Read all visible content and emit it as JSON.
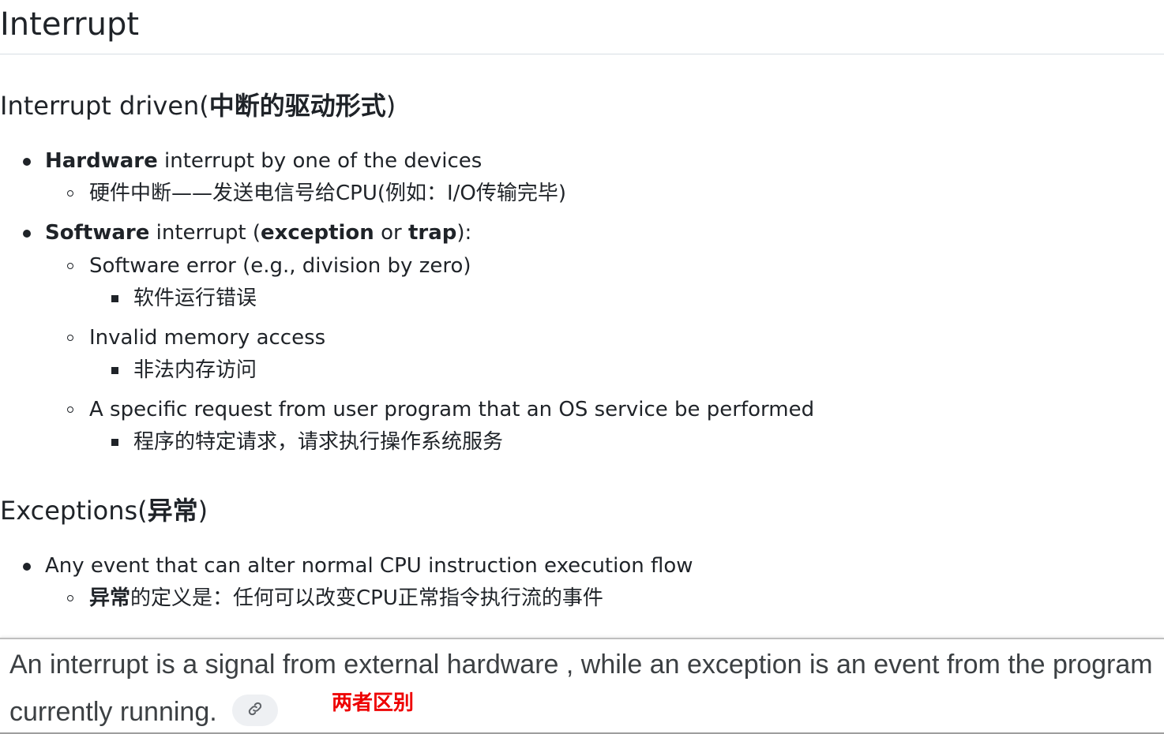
{
  "title": "Interrupt",
  "sections": {
    "interrupt_driven": {
      "heading_en": "Interrupt driven(",
      "heading_cjk": "中断的驱动形式",
      "heading_close": ")",
      "hardware": {
        "bold": "Hardware",
        "rest": " interrupt by one of the devices",
        "sub": "硬件中断——发送电信号给CPU(例如：I/O传输完毕)"
      },
      "software": {
        "bold1": "Software",
        "mid1": " interrupt (",
        "bold2": "exception",
        "mid2": " or ",
        "bold3": "trap",
        "end": "):",
        "items": [
          {
            "text": "Software error (e.g., division by zero)",
            "sub": "软件运行错误"
          },
          {
            "text": "Invalid memory access",
            "sub": "非法内存访问"
          },
          {
            "text": "A specific request from user program that an OS service be performed",
            "sub": "程序的特定请求，请求执行操作系统服务"
          }
        ]
      }
    },
    "exceptions": {
      "heading_en": "Exceptions(",
      "heading_cjk": "异常",
      "heading_close": ")",
      "item": "Any event that can alter normal CPU instruction execution flow",
      "sub_bold": "异常",
      "sub_rest": "的定义是：任何可以改变CPU正常指令执行流的事件"
    }
  },
  "footer": {
    "line1": "An interrupt is a signal from external hardware , while an exception is an event from the program",
    "line2": "currently running.",
    "note": "两者区别",
    "link_icon": "link-icon"
  },
  "colors": {
    "note": "#ee0000",
    "text": "#1f2328",
    "chip": "#eef0f3"
  }
}
